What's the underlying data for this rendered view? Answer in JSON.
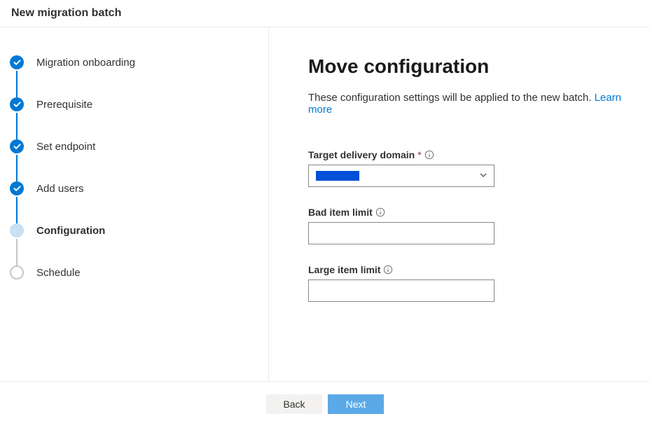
{
  "header": {
    "title": "New migration batch"
  },
  "sidebar": {
    "steps": [
      {
        "label": "Migration onboarding",
        "state": "completed"
      },
      {
        "label": "Prerequisite",
        "state": "completed"
      },
      {
        "label": "Set endpoint",
        "state": "completed"
      },
      {
        "label": "Add users",
        "state": "completed"
      },
      {
        "label": "Configuration",
        "state": "current"
      },
      {
        "label": "Schedule",
        "state": "upcoming"
      }
    ]
  },
  "main": {
    "heading": "Move configuration",
    "description_text": "These configuration settings will be applied to the new batch. ",
    "learn_more_label": "Learn more",
    "fields": {
      "target_domain": {
        "label": "Target delivery domain",
        "required": true,
        "selected": ""
      },
      "bad_item_limit": {
        "label": "Bad item limit",
        "value": ""
      },
      "large_item_limit": {
        "label": "Large item limit",
        "value": ""
      }
    }
  },
  "footer": {
    "back_label": "Back",
    "next_label": "Next"
  }
}
